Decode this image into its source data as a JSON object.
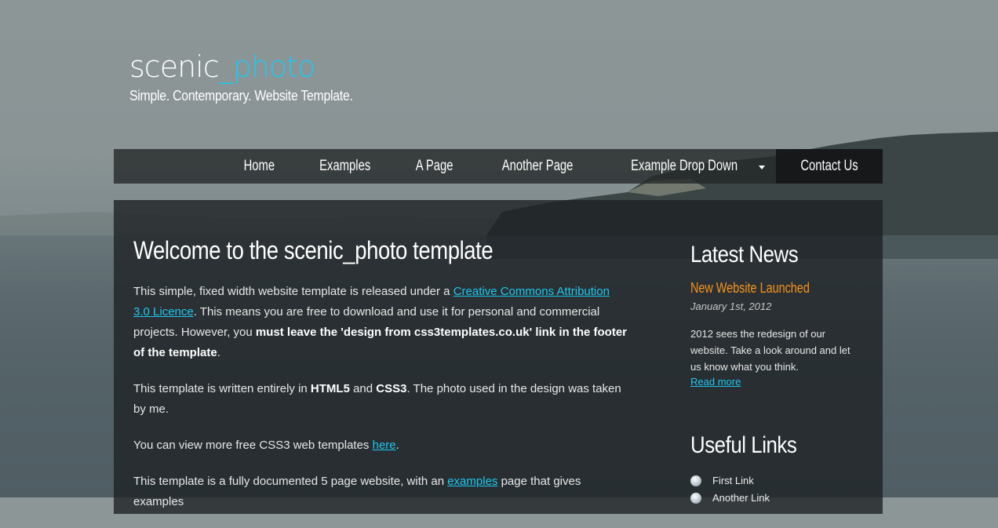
{
  "site": {
    "logo_main": "scenic",
    "logo_accent": "_photo",
    "slogan": "Simple. Contemporary. Website Template."
  },
  "nav": {
    "items": [
      {
        "label": "Home"
      },
      {
        "label": "Examples"
      },
      {
        "label": "A Page"
      },
      {
        "label": "Another Page"
      },
      {
        "label": "Example Drop Down"
      },
      {
        "label": "Contact Us"
      }
    ]
  },
  "content": {
    "heading": "Welcome to the scenic_photo template",
    "p1_a": "This simple, fixed width website template is released under a ",
    "p1_link": "Creative Commons Attribution 3.0 Licence",
    "p1_b": ". This means you are free to download and use it for personal and commercial projects. However, you ",
    "p1_bold": "must leave the 'design from css3templates.co.uk' link in the footer of the template",
    "p1_c": ".",
    "p2_a": "This template is written entirely in ",
    "p2_bold1": "HTML5",
    "p2_b": " and ",
    "p2_bold2": "CSS3",
    "p2_c": ". The photo used in the design was taken by me.",
    "p3_a": "You can view more free CSS3 web templates ",
    "p3_link": "here",
    "p3_b": ".",
    "p4_a": "This template is a fully documented 5 page website, with an ",
    "p4_link": "examples",
    "p4_b": " page that gives examples"
  },
  "sidebar": {
    "news_title": "Latest News",
    "news_headline": "New Website Launched",
    "news_date": "January 1st, 2012",
    "news_body": "2012 sees the redesign of our website. Take a look around and let us know what you think.",
    "news_more": "Read more",
    "links_title": "Useful Links",
    "links": [
      {
        "label": "First Link"
      },
      {
        "label": "Another Link"
      }
    ]
  },
  "colors": {
    "accent": "#1ec8f0",
    "news_headline": "#f7941d",
    "panel": "#1c2023"
  }
}
